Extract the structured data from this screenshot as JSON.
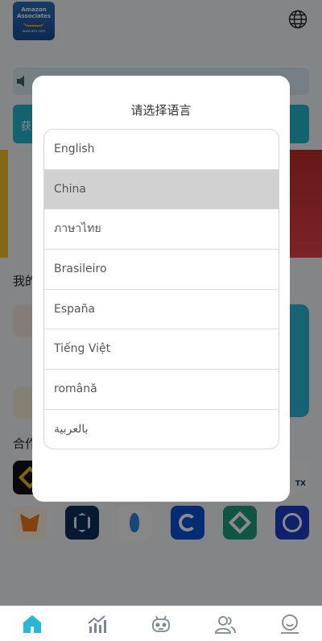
{
  "header": {
    "logo_line1": "Amazon",
    "logo_line2": "Associates",
    "logo_tagline": "www.aim.com",
    "language_icon": "globe-icon"
  },
  "background": {
    "notice_icon": "speaker-icon",
    "action_left_label": "获",
    "section_mine_label": "我的",
    "section_partners_label": "合作"
  },
  "partners": [
    {
      "name": "binance-logo"
    },
    {
      "name": "htx-logo",
      "label": "TX"
    },
    {
      "name": "metamask-logo"
    },
    {
      "name": "crypto-com-logo"
    },
    {
      "name": "huobi-logo"
    },
    {
      "name": "coinbase-logo"
    },
    {
      "name": "kucoin-logo"
    },
    {
      "name": "coinmarketcap-logo"
    }
  ],
  "dialog": {
    "title": "请选择语言",
    "selected_index": 1,
    "languages": [
      "English",
      "China",
      "ภาษาไทย",
      "Brasileiro",
      "España",
      "Tiếng Việt",
      "română",
      "بالعربية"
    ]
  },
  "tabbar": {
    "tabs": [
      {
        "icon": "home-icon",
        "active": true
      },
      {
        "icon": "market-chart-icon",
        "active": false
      },
      {
        "icon": "robot-icon",
        "active": false
      },
      {
        "icon": "team-icon",
        "active": false
      },
      {
        "icon": "profile-icon",
        "active": false
      }
    ],
    "active_color": "#28b7d8",
    "inactive_color": "#7a8693"
  },
  "colors": {
    "accent": "#28b7d8",
    "selected_row": "#d1d1d1"
  }
}
